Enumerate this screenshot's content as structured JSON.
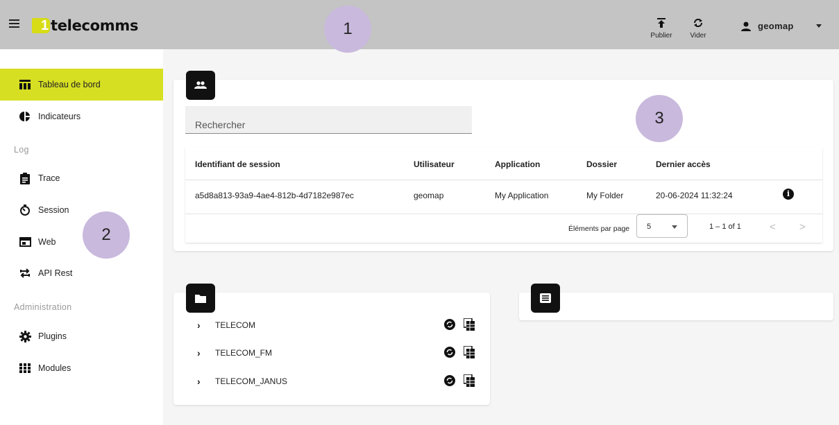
{
  "brand": {
    "logo_digit": "1",
    "logo_text": "telecomms",
    "accent": "#d7df23"
  },
  "topbar": {
    "publish_label": "Publier",
    "clear_label": "Vider",
    "username": "geomap"
  },
  "markers": {
    "m1": "1",
    "m2": "2",
    "m3": "3"
  },
  "sidebar": {
    "items": [
      {
        "label": "Tableau de bord",
        "icon": "dashboard-icon",
        "active": true
      },
      {
        "label": "Indicateurs",
        "icon": "pie-chart-icon"
      }
    ],
    "sections": {
      "log": {
        "title": "Log",
        "items": [
          {
            "label": "Trace",
            "icon": "clipboard-icon"
          },
          {
            "label": "Session",
            "icon": "timer-icon"
          },
          {
            "label": "Web",
            "icon": "browser-window-icon"
          },
          {
            "label": "API Rest",
            "icon": "swap-arrows-icon"
          }
        ]
      },
      "admin": {
        "title": "Administration",
        "items": [
          {
            "label": "Plugins",
            "icon": "gear-icon"
          },
          {
            "label": "Modules",
            "icon": "grid-icon"
          }
        ]
      }
    }
  },
  "sessions": {
    "search_placeholder": "Rechercher",
    "columns": [
      "Identifiant de session",
      "Utilisateur",
      "Application",
      "Dossier",
      "Dernier accès"
    ],
    "rows": [
      [
        "a5d8a813-93a9-4ae4-812b-4d7182e987ec",
        "geomap",
        "My Application",
        "My Folder",
        "20-06-2024 11:32:24"
      ]
    ],
    "pager": {
      "per_page_label": "Éléments par page",
      "per_page_value": "5",
      "range": "1 – 1 of 1",
      "prev": "<",
      "next": ">"
    }
  },
  "folders": {
    "items": [
      "TELECOM",
      "TELECOM_FM",
      "TELECOM_JANUS"
    ]
  }
}
